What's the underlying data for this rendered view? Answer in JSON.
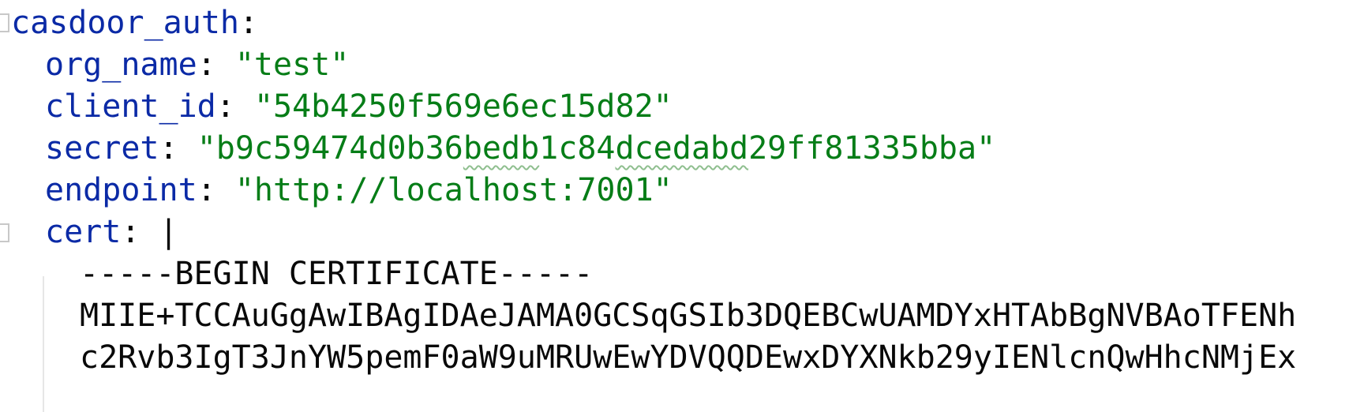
{
  "editor": {
    "root_key": "casdoor_auth",
    "colon": ":",
    "entries": [
      {
        "key": "org_name",
        "value": "\"test\""
      },
      {
        "key": "client_id",
        "value": "\"54b4250f569e6ec15d82\""
      },
      {
        "key": "secret",
        "value_parts": [
          "\"b9c59474d0b36",
          "bedb",
          "1c84",
          "dcedabd",
          "29ff81335bba\""
        ]
      },
      {
        "key": "endpoint",
        "value": "\"http://localhost:7001\""
      },
      {
        "key": "cert",
        "value": "|"
      }
    ],
    "cert_lines": [
      "-----BEGIN CERTIFICATE-----",
      "MIIE+TCCAuGgAwIBAgIDAeJAMA0GCSqGSIb3DQEBCwUAMDYxHTAbBgNVBAoTFENh",
      "c2Rvb3IgT3JnYW5pemF0aW9uMRUwEwYDVQQDEwxDYXNkb29yIENlcnQwHhcNMjEx"
    ],
    "colors": {
      "key": "#0b2aa6",
      "string": "#067d17",
      "text": "#080808"
    }
  }
}
